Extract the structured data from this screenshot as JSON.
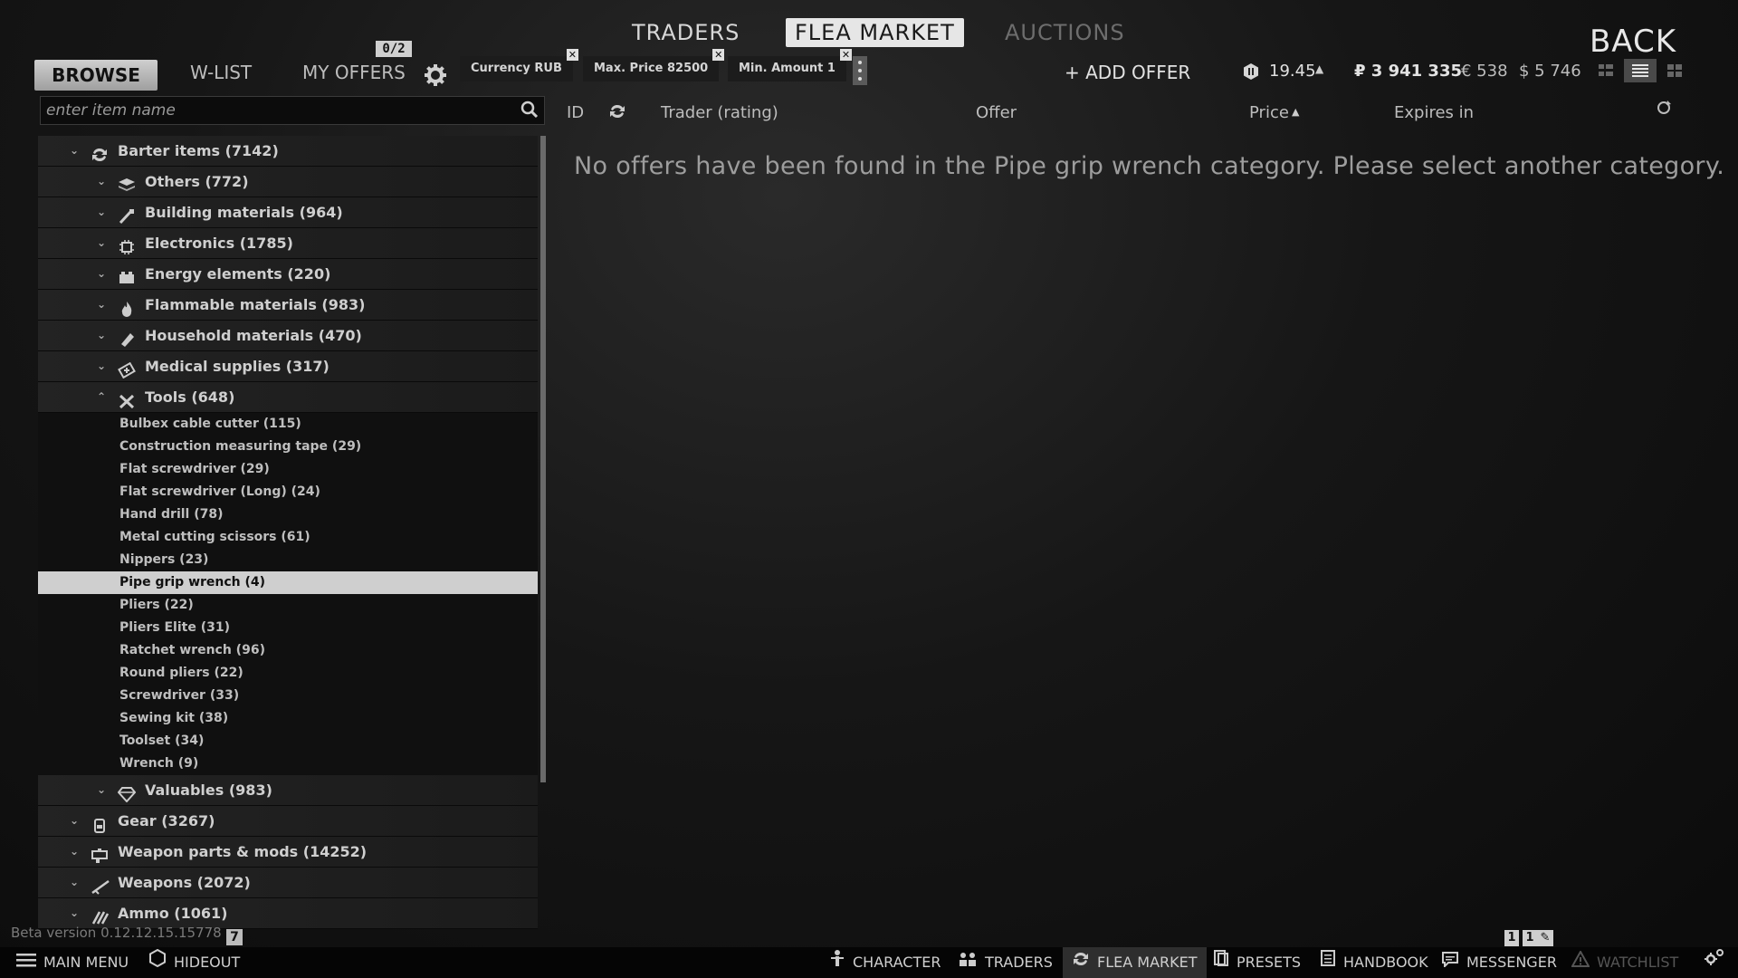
{
  "top_nav": {
    "traders": "TRADERS",
    "flea_market": "FLEA MARKET",
    "auctions": "AUCTIONS",
    "back": "BACK"
  },
  "sub_nav": {
    "browse": "BROWSE",
    "wlist": "W-LIST",
    "my_offers": "MY OFFERS",
    "offers_count": "0/2"
  },
  "filters": [
    {
      "label": "Currency RUB"
    },
    {
      "label": "Max. Price 82500"
    },
    {
      "label": "Min. Amount 1"
    }
  ],
  "add_offer": "+ ADD OFFER",
  "rating": "19.45",
  "balances": {
    "rub": "₽ 3 941 335",
    "eur": "€ 538",
    "usd": "$ 5 746"
  },
  "search": {
    "placeholder": "enter item name"
  },
  "tree": {
    "barter": "Barter items (7142)",
    "others": "Others (772)",
    "building": "Building materials (964)",
    "electronics": "Electronics (1785)",
    "energy": "Energy elements (220)",
    "flammable": "Flammable materials (983)",
    "household": "Household materials (470)",
    "medical": "Medical supplies (317)",
    "tools": "Tools (648)",
    "tool_items": [
      "Bulbex cable cutter (115)",
      "Construction measuring tape (29)",
      "Flat screwdriver (29)",
      "Flat screwdriver (Long) (24)",
      "Hand drill (78)",
      "Metal cutting scissors (61)",
      "Nippers (23)",
      "Pipe grip wrench (4)",
      "Pliers (22)",
      "Pliers Elite (31)",
      "Ratchet wrench (96)",
      "Round pliers (22)",
      "Screwdriver (33)",
      "Sewing kit (38)",
      "Toolset (34)",
      "Wrench (9)"
    ],
    "valuables": "Valuables (983)",
    "gear": "Gear (3267)",
    "weapon_parts": "Weapon parts & mods (14252)",
    "weapons": "Weapons (2072)",
    "ammo": "Ammo (1061)"
  },
  "table": {
    "id": "ID",
    "trader": "Trader (rating)",
    "offer": "Offer",
    "price": "Price",
    "expires": "Expires in",
    "empty_message": "No offers have been found in the Pipe grip wrench category. Please select another category."
  },
  "beta": {
    "text": "Beta version 0.12.12.15.15778",
    "badge": "7"
  },
  "pager": {
    "page": "1",
    "pages": "1"
  },
  "bottom_bar": {
    "main_menu": "MAIN MENU",
    "hideout": "HIDEOUT",
    "character": "CHARACTER",
    "traders": "TRADERS",
    "flea_market": "FLEA MARKET",
    "presets": "PRESETS",
    "handbook": "HANDBOOK",
    "messenger": "MESSENGER",
    "watchlist": "WATCHLIST"
  }
}
